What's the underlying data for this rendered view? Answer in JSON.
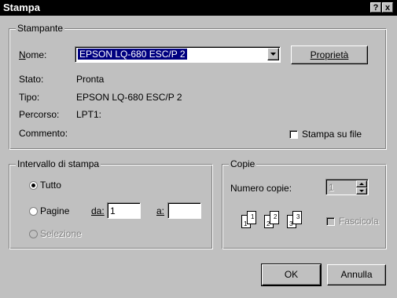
{
  "window": {
    "title": "Stampa",
    "help_btn": "?",
    "close_btn": "x"
  },
  "printer": {
    "group_label": "Stampante",
    "name_label": "Nome:",
    "name_value": "EPSON LQ-680 ESC/P 2",
    "properties_button": "Proprietà",
    "status_label": "Stato:",
    "status_value": "Pronta",
    "type_label": "Tipo:",
    "type_value": "EPSON LQ-680 ESC/P 2",
    "path_label": "Percorso:",
    "path_value": "LPT1:",
    "comment_label": "Commento:",
    "print_to_file_label": "Stampa su file",
    "print_to_file_checked": false
  },
  "range": {
    "group_label": "Intervallo di stampa",
    "all_label": "Tutto",
    "pages_label": "Pagine",
    "from_label": "da:",
    "from_value": "1",
    "to_label": "a:",
    "to_value": "",
    "selection_label": "Selezione",
    "selected": "all"
  },
  "copies": {
    "group_label": "Copie",
    "num_label": "Numero copie:",
    "num_value": "1",
    "collate_label": "Fascicola",
    "collate_enabled": false,
    "page_numbers": [
      "1",
      "1",
      "2",
      "2",
      "3",
      "3"
    ]
  },
  "buttons": {
    "ok": "OK",
    "cancel": "Annulla"
  }
}
